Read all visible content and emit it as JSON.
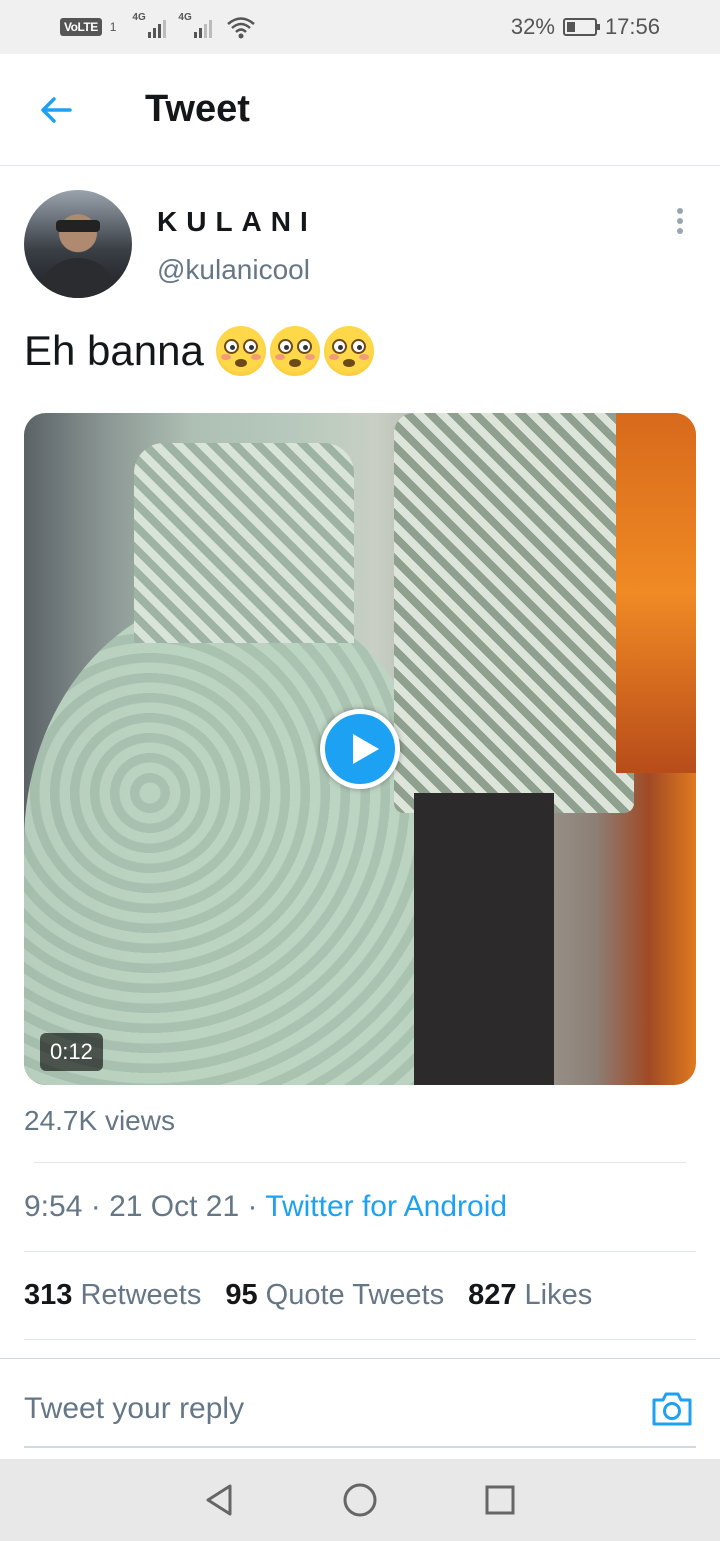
{
  "status_bar": {
    "network_label": "VoLTE",
    "sim_slot": "1",
    "signal1_label": "4G",
    "signal2_label": "4G",
    "battery_percent": "32%",
    "battery_level": 0.32,
    "time": "17:56"
  },
  "header": {
    "title": "Tweet"
  },
  "tweet": {
    "author_name": "KULANI",
    "author_handle": "@kulanicool",
    "text": "Eh banna",
    "emoji_count": 3,
    "video_duration": "0:12",
    "views": "24.7K views",
    "time": "9:54",
    "date": "21 Oct 21",
    "separator": "·",
    "source": "Twitter for Android",
    "stats": {
      "retweets_count": "313",
      "retweets_label": "Retweets",
      "quote_count": "95",
      "quote_label": "Quote Tweets",
      "likes_count": "827",
      "likes_label": "Likes"
    }
  },
  "reply": {
    "placeholder": "Tweet your reply"
  },
  "colors": {
    "accent": "#1da1f2",
    "text_primary": "#14171a",
    "text_secondary": "#657786",
    "divider": "#e1e8ed"
  },
  "icons": {
    "back": "arrow-left-icon",
    "more": "more-vertical-icon",
    "play": "play-icon",
    "camera": "camera-icon",
    "nav_back": "triangle-back-icon",
    "nav_home": "circle-home-icon",
    "nav_recents": "square-recents-icon"
  }
}
